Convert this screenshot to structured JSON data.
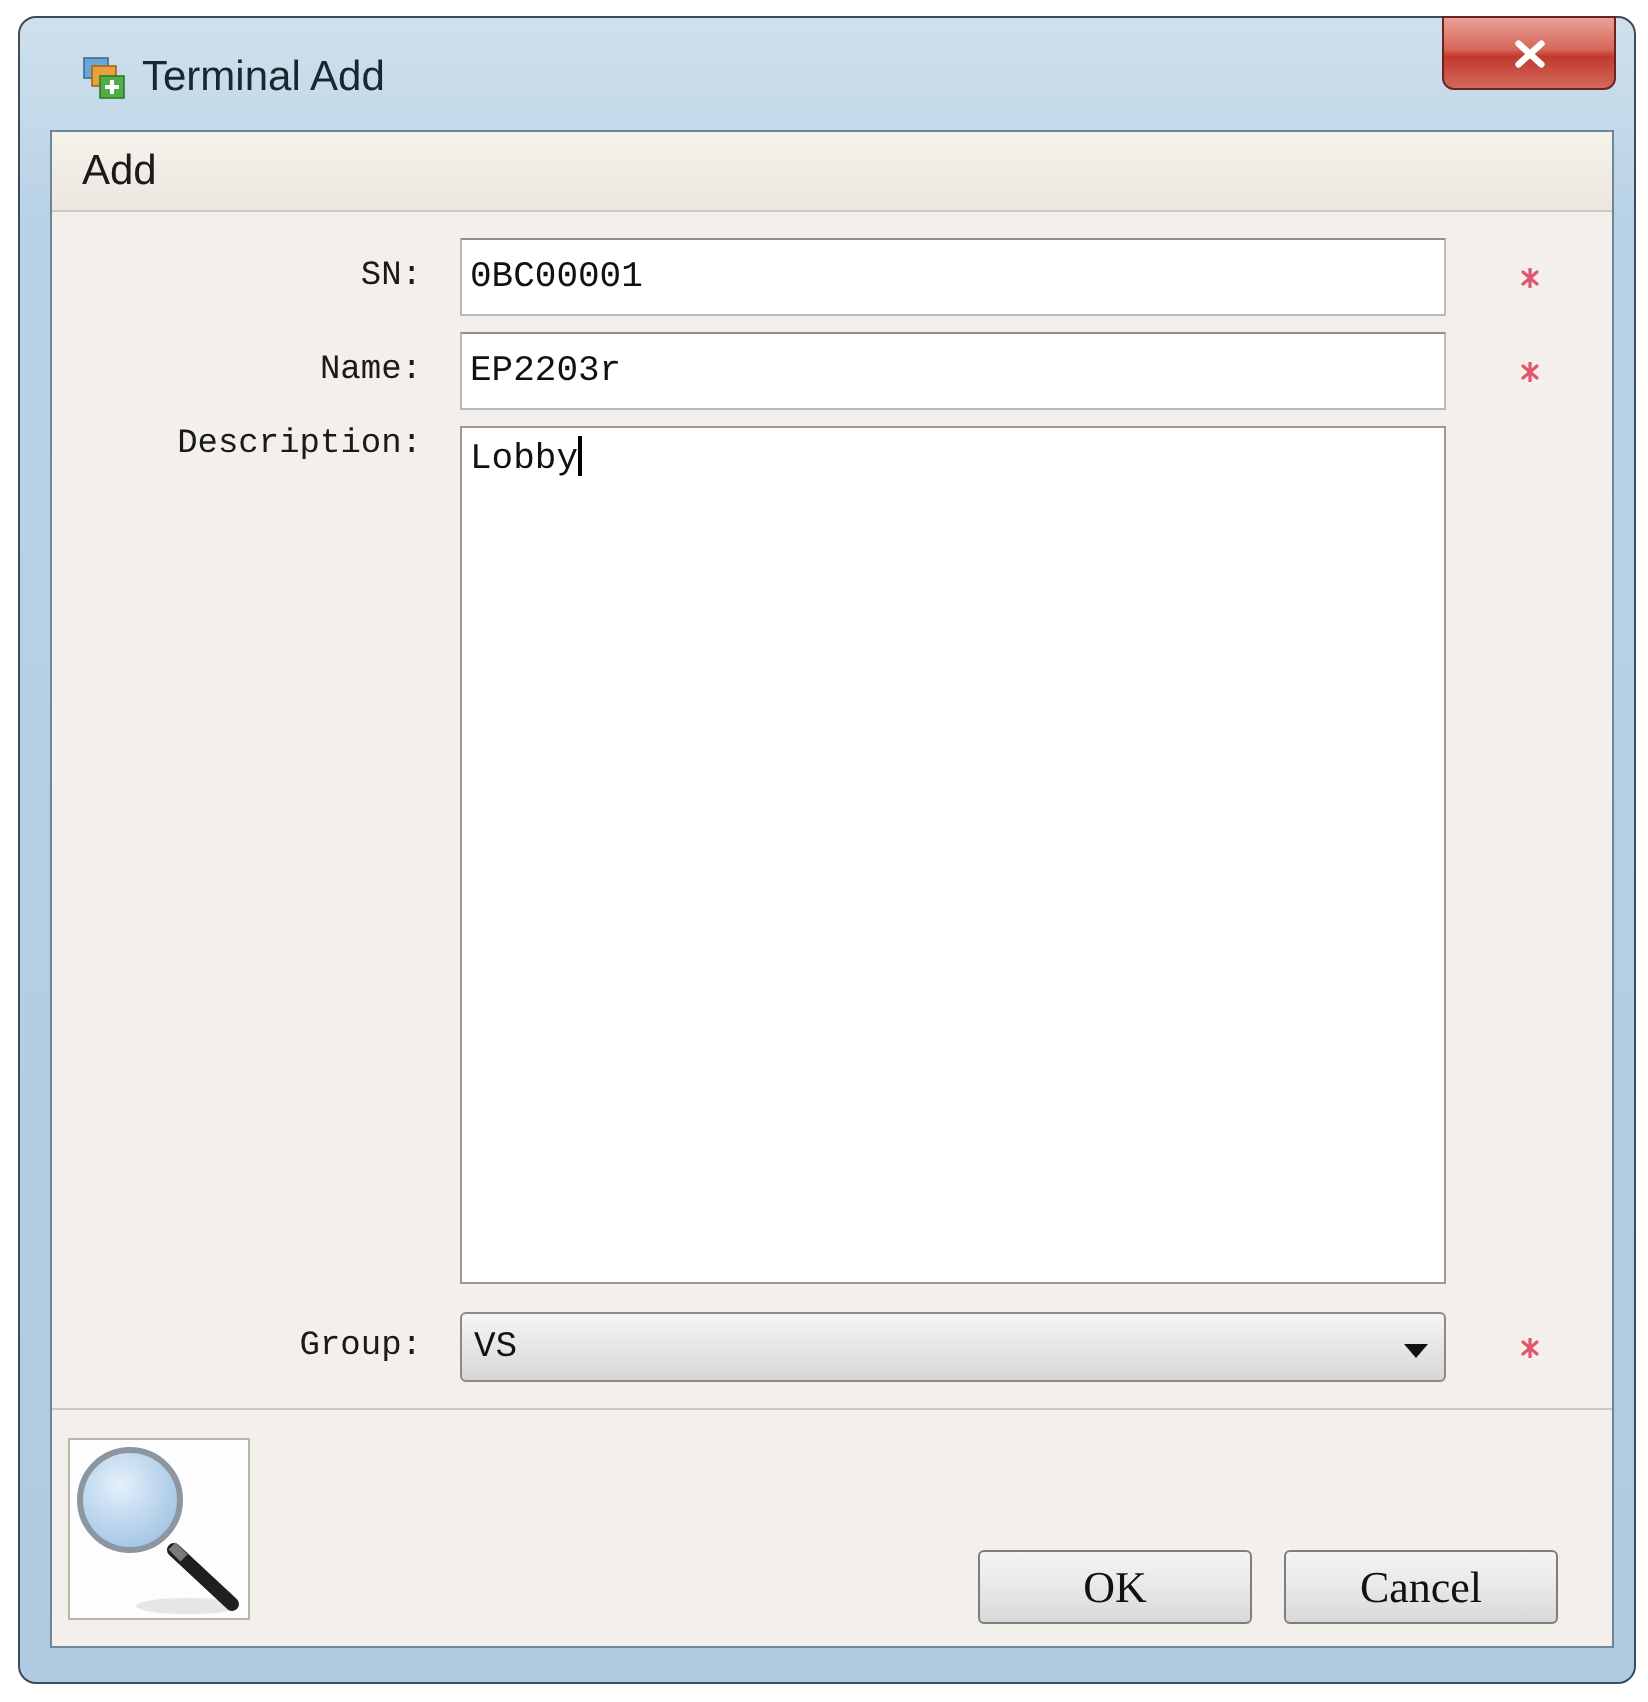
{
  "window": {
    "title": "Terminal Add"
  },
  "section": {
    "title": "Add"
  },
  "fields": [
    {
      "kind": "text",
      "label": "SN:",
      "value": "0BC00001",
      "required": true
    },
    {
      "kind": "text",
      "label": "Name:",
      "value": "EP2203r",
      "required": true
    },
    {
      "kind": "textarea",
      "label": "Description:",
      "value": "Lobby",
      "focused": true
    },
    {
      "kind": "select",
      "label": "Group:",
      "value": "VS",
      "required": true
    }
  ],
  "buttons": [
    {
      "label": "OK"
    },
    {
      "label": "Cancel"
    }
  ]
}
